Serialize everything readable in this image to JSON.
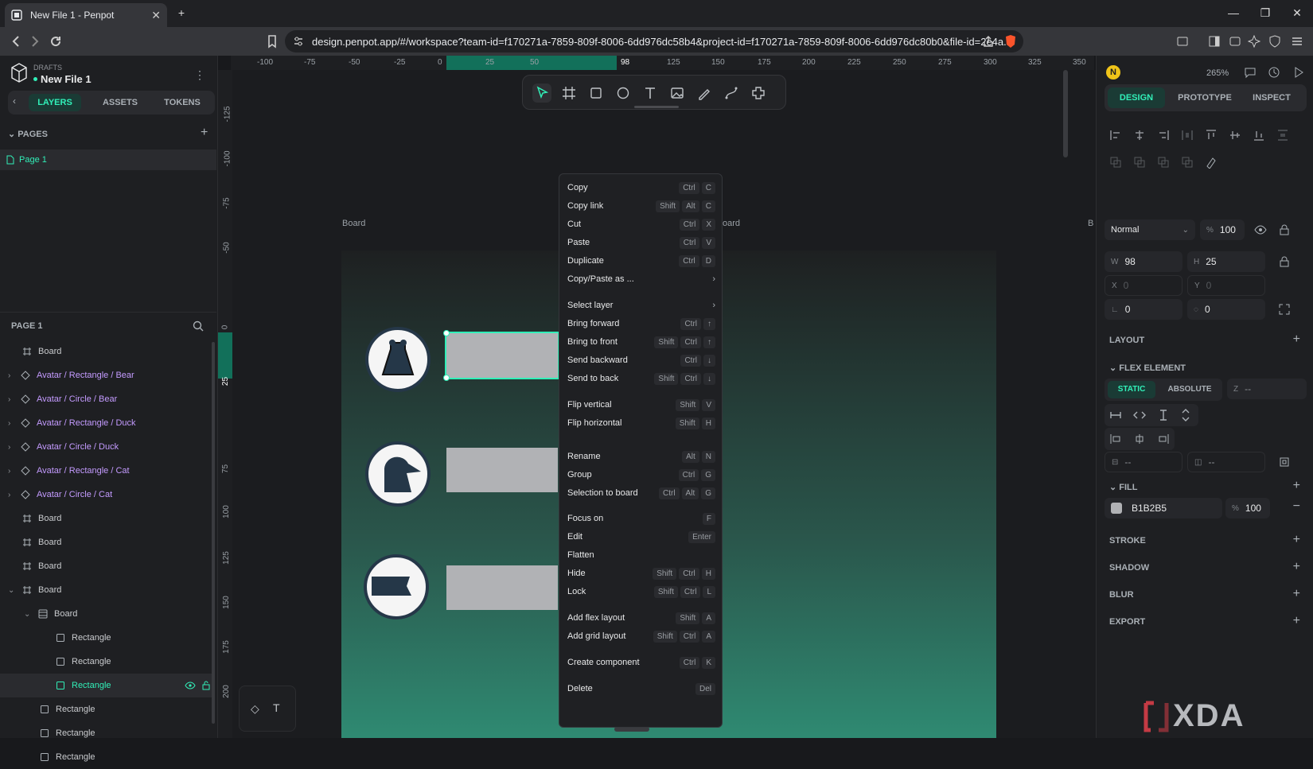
{
  "browser": {
    "tab_title": "New File 1 - Penpot",
    "url": "design.penpot.app/#/workspace?team-id=f170271a-7859-809f-8006-6dd976dc58b4&project-id=f170271a-7859-809f-8006-6dd976dc80b0&file-id=2e4a..."
  },
  "project": {
    "drafts_label": "DRAFTS",
    "file_name": "New File 1"
  },
  "left_tabs": [
    "LAYERS",
    "ASSETS",
    "TOKENS"
  ],
  "pages": {
    "header": "PAGES",
    "items": [
      "Page 1"
    ]
  },
  "layers": {
    "header": "PAGE 1",
    "items": [
      {
        "label": "Board",
        "kind": "board"
      },
      {
        "label": "Avatar / Rectangle / Bear",
        "kind": "component"
      },
      {
        "label": "Avatar / Circle / Bear",
        "kind": "component"
      },
      {
        "label": "Avatar / Rectangle / Duck",
        "kind": "component"
      },
      {
        "label": "Avatar / Circle / Duck",
        "kind": "component"
      },
      {
        "label": "Avatar / Rectangle / Cat",
        "kind": "component"
      },
      {
        "label": "Avatar / Circle / Cat",
        "kind": "component"
      },
      {
        "label": "Board",
        "kind": "board"
      },
      {
        "label": "Board",
        "kind": "board"
      },
      {
        "label": "Board",
        "kind": "board"
      },
      {
        "label": "Board",
        "kind": "board"
      },
      {
        "label": "Board",
        "kind": "flex-board"
      },
      {
        "label": "Rectangle",
        "kind": "rect"
      },
      {
        "label": "Rectangle",
        "kind": "rect"
      },
      {
        "label": "Rectangle",
        "kind": "rect-selected"
      },
      {
        "label": "Rectangle",
        "kind": "rect"
      },
      {
        "label": "Rectangle",
        "kind": "rect"
      },
      {
        "label": "Rectangle",
        "kind": "rect"
      }
    ]
  },
  "ruler_h": [
    "-100",
    "-75",
    "-50",
    "-25",
    "0",
    "25",
    "50",
    "98",
    "125",
    "150",
    "175",
    "200",
    "225",
    "250",
    "275",
    "300",
    "325",
    "350"
  ],
  "ruler_v": [
    "-125",
    "-100",
    "-75",
    "-50",
    "0",
    "25",
    "75",
    "100",
    "125",
    "150",
    "175",
    "200"
  ],
  "canvas": {
    "board_label_left": "Board",
    "board_label_right": "oard",
    "board_label_far": "B"
  },
  "context_menu": [
    {
      "label": "Copy",
      "keys": [
        "Ctrl",
        "C"
      ]
    },
    {
      "label": "Copy link",
      "keys": [
        "Shift",
        "Alt",
        "C"
      ]
    },
    {
      "label": "Cut",
      "keys": [
        "Ctrl",
        "X"
      ]
    },
    {
      "label": "Paste",
      "keys": [
        "Ctrl",
        "V"
      ]
    },
    {
      "label": "Duplicate",
      "keys": [
        "Ctrl",
        "D"
      ]
    },
    {
      "label": "Copy/Paste as ...",
      "keys": [],
      "submenu": true
    },
    {
      "label": "Select layer",
      "keys": [],
      "submenu": true
    },
    {
      "label": "Bring forward",
      "keys": [
        "Ctrl",
        "↑"
      ]
    },
    {
      "label": "Bring to front",
      "keys": [
        "Shift",
        "Ctrl",
        "↑"
      ]
    },
    {
      "label": "Send backward",
      "keys": [
        "Ctrl",
        "↓"
      ]
    },
    {
      "label": "Send to back",
      "keys": [
        "Shift",
        "Ctrl",
        "↓"
      ]
    },
    {
      "label": "Flip vertical",
      "keys": [
        "Shift",
        "V"
      ]
    },
    {
      "label": "Flip horizontal",
      "keys": [
        "Shift",
        "H"
      ]
    },
    {
      "label": "Rename",
      "keys": [
        "Alt",
        "N"
      ]
    },
    {
      "label": "Group",
      "keys": [
        "Ctrl",
        "G"
      ]
    },
    {
      "label": "Selection to board",
      "keys": [
        "Ctrl",
        "Alt",
        "G"
      ]
    },
    {
      "label": "Focus on",
      "keys": [
        "F"
      ]
    },
    {
      "label": "Edit",
      "keys": [
        "Enter"
      ]
    },
    {
      "label": "Flatten",
      "keys": []
    },
    {
      "label": "Hide",
      "keys": [
        "Shift",
        "Ctrl",
        "H"
      ]
    },
    {
      "label": "Lock",
      "keys": [
        "Shift",
        "Ctrl",
        "L"
      ]
    },
    {
      "label": "Add flex layout",
      "keys": [
        "Shift",
        "A"
      ]
    },
    {
      "label": "Add grid layout",
      "keys": [
        "Shift",
        "Ctrl",
        "A"
      ]
    },
    {
      "label": "Create component",
      "keys": [
        "Ctrl",
        "K"
      ]
    },
    {
      "label": "Delete",
      "keys": [
        "Del"
      ]
    }
  ],
  "right": {
    "avatar_initial": "N",
    "zoom": "265%",
    "tabs": [
      "DESIGN",
      "PROTOTYPE",
      "INSPECT"
    ],
    "blend_mode": "Normal",
    "opacity_symbol": "%",
    "opacity": "100",
    "w_label": "W",
    "w": "98",
    "h_label": "H",
    "h": "25",
    "x_label": "X",
    "x": "0",
    "y_label": "Y",
    "y": "0",
    "rotation": "0",
    "radius": "0",
    "layout_label": "LAYOUT",
    "flex_element_label": "FLEX ELEMENT",
    "position_static": "STATIC",
    "position_absolute": "ABSOLUTE",
    "z_label": "Z",
    "z_value": "--",
    "margin_value_1": "--",
    "margin_value_2": "--",
    "fill_label": "FILL",
    "fill_hex": "B1B2B5",
    "fill_color": "#b1b2b5",
    "fill_opacity": "100",
    "stroke_label": "STROKE",
    "shadow_label": "SHADOW",
    "blur_label": "BLUR",
    "export_label": "EXPORT"
  },
  "watermark": "XDA",
  "colors": {
    "accent": "#31efb8",
    "selection": "#12a886"
  }
}
